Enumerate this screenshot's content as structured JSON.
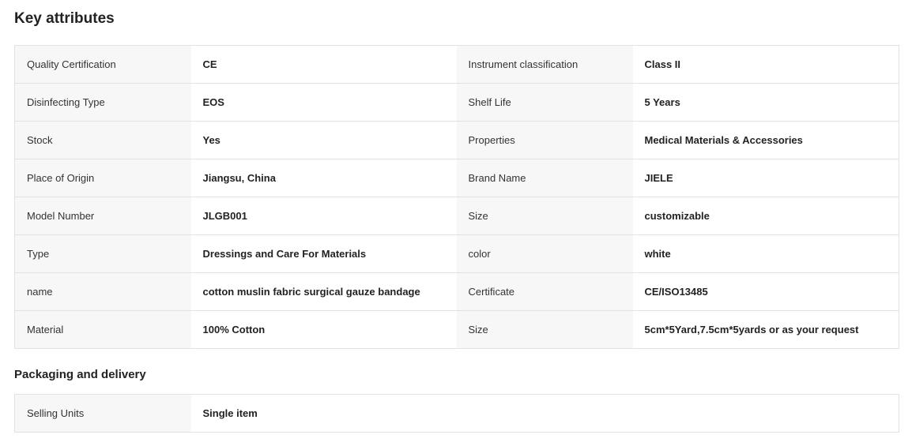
{
  "key_attributes": {
    "title": "Key attributes",
    "rows": [
      [
        {
          "label": "Quality Certification",
          "value": "CE"
        },
        {
          "label": "Instrument classification",
          "value": "Class II"
        }
      ],
      [
        {
          "label": "Disinfecting Type",
          "value": "EOS"
        },
        {
          "label": "Shelf Life",
          "value": "5 Years"
        }
      ],
      [
        {
          "label": "Stock",
          "value": "Yes"
        },
        {
          "label": "Properties",
          "value": "Medical Materials & Accessories"
        }
      ],
      [
        {
          "label": "Place of Origin",
          "value": "Jiangsu, China"
        },
        {
          "label": "Brand Name",
          "value": "JIELE"
        }
      ],
      [
        {
          "label": "Model Number",
          "value": "JLGB001"
        },
        {
          "label": "Size",
          "value": "customizable"
        }
      ],
      [
        {
          "label": "Type",
          "value": "Dressings and Care For Materials"
        },
        {
          "label": "color",
          "value": "white"
        }
      ],
      [
        {
          "label": "name",
          "value": "cotton muslin fabric surgical gauze bandage"
        },
        {
          "label": "Certificate",
          "value": "CE/ISO13485"
        }
      ],
      [
        {
          "label": "Material",
          "value": "100% Cotton"
        },
        {
          "label": "Size",
          "value": "5cm*5Yard,7.5cm*5yards or as your request"
        }
      ]
    ]
  },
  "packaging": {
    "title": "Packaging and delivery",
    "rows": [
      [
        {
          "label": "Selling Units",
          "value": "Single item"
        }
      ]
    ]
  },
  "colors": {
    "label_bg": "#f7f7f7",
    "border": "#e2e2e2",
    "text": "#222222"
  }
}
